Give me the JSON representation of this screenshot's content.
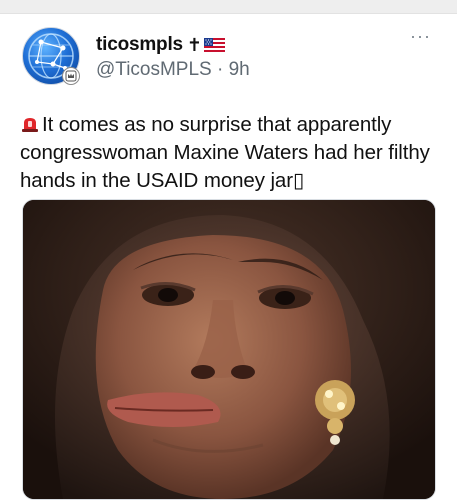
{
  "user": {
    "display_name": "ticosmpls",
    "name_suffix": "✝",
    "handle": "@TicosMPLS",
    "separator": " · ",
    "time": "9h",
    "avatar_icon": "globe-network-avatar",
    "badge_icon": "crown-badge-icon"
  },
  "menu": {
    "more_label": "···"
  },
  "tweet": {
    "text": "It comes as no surprise that apparently congresswoman Maxine Waters had her filthy hands in the USAID money jar",
    "trailing_glyph": "▯",
    "leading_icon": "police-siren-icon"
  },
  "media": {
    "kind": "photo",
    "description_icon": "photo-portrait"
  },
  "colors": {
    "text": "#111111",
    "secondary": "#606a73",
    "background": "#ffffff",
    "siren_red": "#e0262a"
  }
}
